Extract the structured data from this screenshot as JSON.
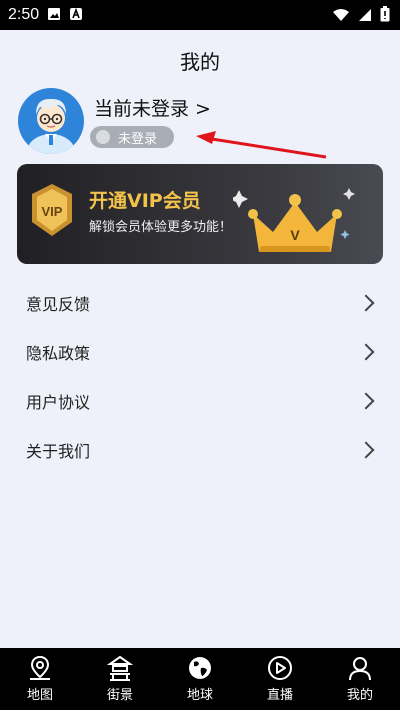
{
  "status_bar": {
    "time": "2:50"
  },
  "header": {
    "title": "我的"
  },
  "profile": {
    "login_prompt": "当前未登录 >",
    "status_badge": "未登录"
  },
  "vip": {
    "title": "开通VIP会员",
    "subtitle": "解锁会员体验更多功能！",
    "badge_text": "VIP",
    "crown_letter": "V"
  },
  "menu": [
    {
      "label": "意见反馈"
    },
    {
      "label": "隐私政策"
    },
    {
      "label": "用户协议"
    },
    {
      "label": "关于我们"
    }
  ],
  "bottom_nav": [
    {
      "label": "地图",
      "icon": "map-pin-icon"
    },
    {
      "label": "街景",
      "icon": "pagoda-icon"
    },
    {
      "label": "地球",
      "icon": "globe-icon"
    },
    {
      "label": "直播",
      "icon": "play-circle-icon"
    },
    {
      "label": "我的",
      "icon": "user-icon"
    }
  ],
  "colors": {
    "accent_gold": "#f3c24a",
    "arrow_red": "#e0141b",
    "avatar_blue": "#2e84d8"
  }
}
